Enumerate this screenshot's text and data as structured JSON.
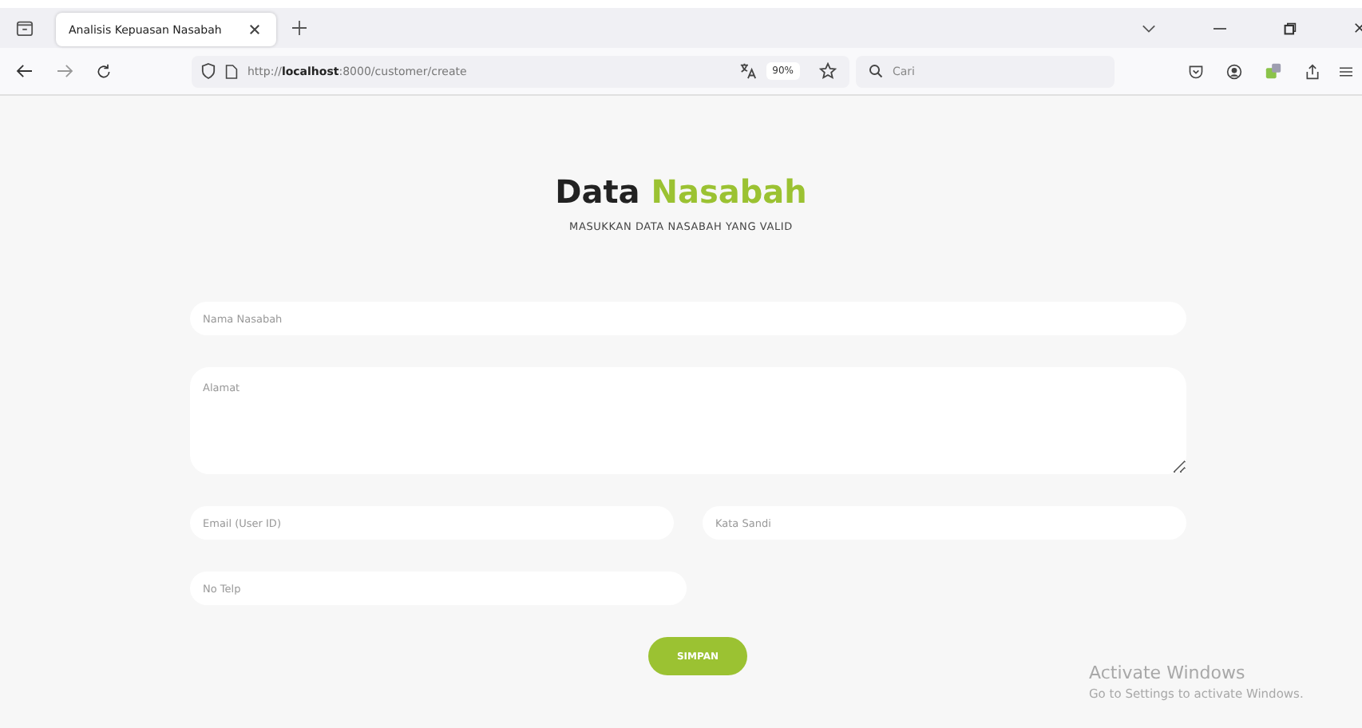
{
  "browser": {
    "tabs": [
      {
        "label": "Analisis Kepuasan Nasabah",
        "selected": true
      }
    ],
    "address": "http://**localhost**:8000/customer/create",
    "zoom": "90%",
    "search": {
      "placeholder": "Cari"
    }
  },
  "page": {
    "title": "Data",
    "title_highlight": "Nasabah",
    "subtitle": "MASUKKAN DATA NASABAH YANG VALID",
    "rows": [
      {
        "fields": [
          {
            "kind": "input",
            "placeholder": "Nama Nasabah"
          }
        ]
      },
      {
        "fields": [
          {
            "kind": "textarea",
            "placeholder": "Alamat"
          }
        ]
      },
      {
        "fields": [
          {
            "kind": "input",
            "placeholder": "Email (User ID)"
          },
          {
            "kind": "input",
            "placeholder": "Kata Sandi"
          }
        ]
      },
      {
        "fields": [
          {
            "kind": "input",
            "placeholder": "No Telp"
          },
          {
            "kind": "spacer"
          }
        ]
      }
    ],
    "submit": "SIMPAN"
  },
  "os_notice": {
    "title": "Activate Windows",
    "text": "Go to Settings to activate Windows."
  }
}
